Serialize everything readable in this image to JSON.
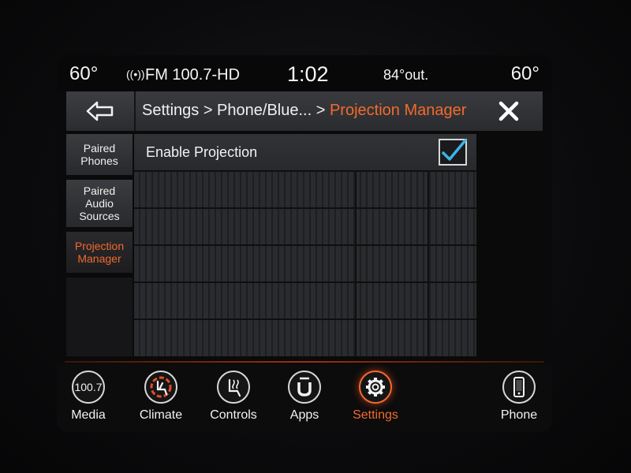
{
  "status_bar": {
    "temp_left": "60°",
    "radio": "FM 100.7-HD",
    "time": "1:02",
    "outside": "84°out.",
    "temp_right": "60°"
  },
  "header": {
    "breadcrumb_prefix": "Settings > Phone/Blue... > ",
    "breadcrumb_current": "Projection Manager"
  },
  "tabs": [
    {
      "label": "Paired\nPhones"
    },
    {
      "label": "Paired\nAudio\nSources"
    },
    {
      "label": "Projection\nManager",
      "active": true
    }
  ],
  "settings": {
    "enable_projection_label": "Enable Projection",
    "enable_projection_checked": true
  },
  "nav": {
    "media_label": "Media",
    "media_icon_text": "100.7",
    "climate_label": "Climate",
    "controls_label": "Controls",
    "apps_label": "Apps",
    "settings_label": "Settings",
    "phone_label": "Phone"
  },
  "colors": {
    "accent": "#f26a2e",
    "check": "#3cb4e6"
  }
}
